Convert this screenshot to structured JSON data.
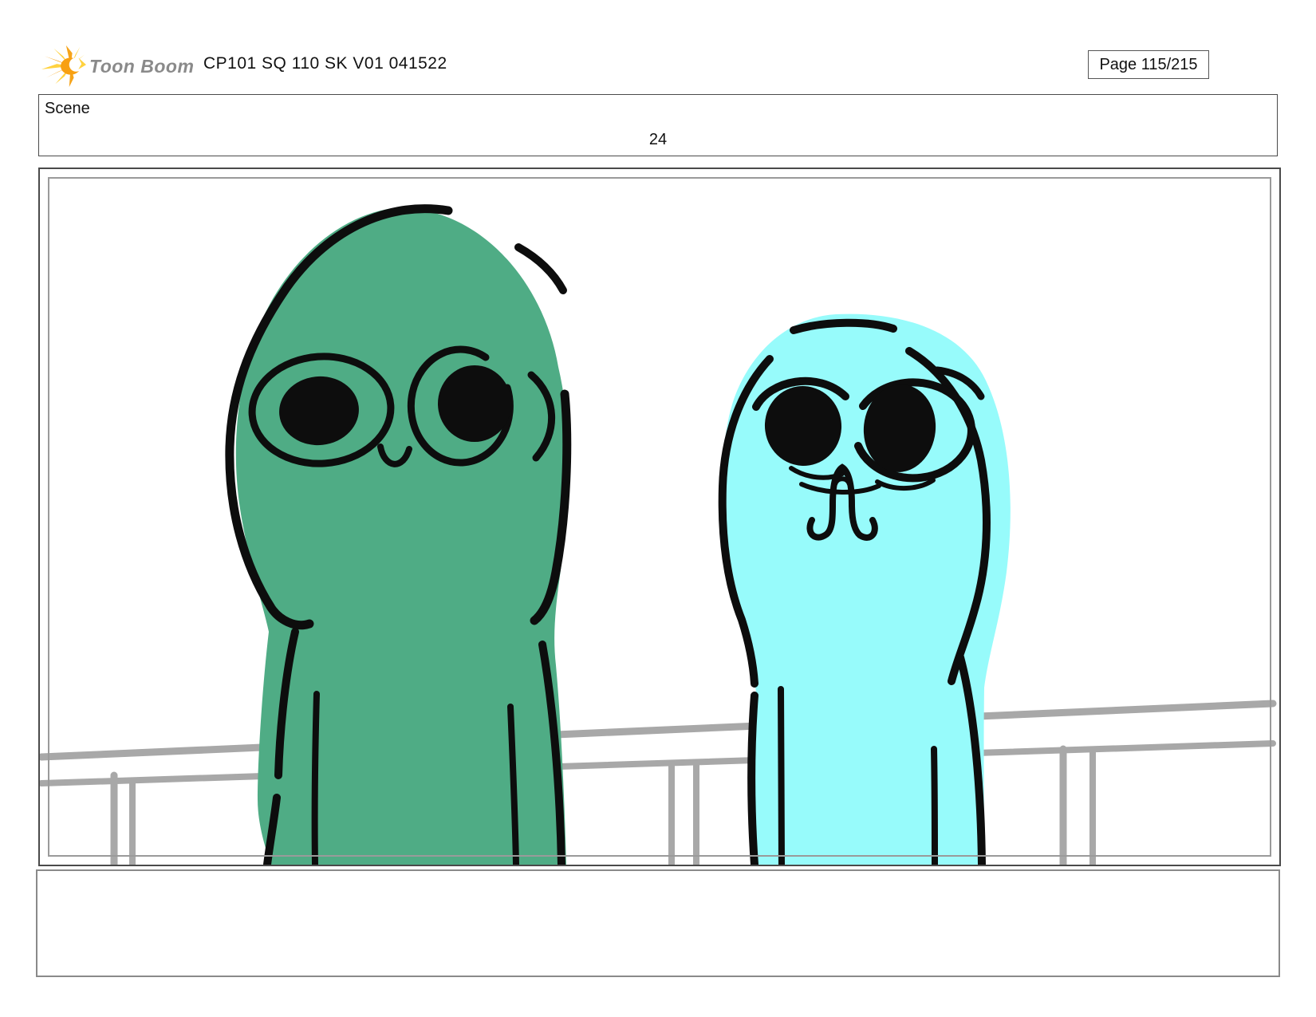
{
  "header": {
    "logo_text": "Toon Boom",
    "title": "CP101 SQ 110 SK V01 041522",
    "page_label": "Page 115/215"
  },
  "scene_row": {
    "label": "Scene",
    "number": "24"
  },
  "caption": {
    "text": ""
  },
  "panel": {
    "icon_names": [
      "toonboom-logo-icon",
      "storyboard-panel-drawing"
    ],
    "characters": [
      "green-blob-character",
      "cyan-blob-character"
    ],
    "background_element": "gray-railing"
  },
  "colors": {
    "character_green_fill": "#4fac85",
    "character_cyan_fill": "#97fbfb",
    "line_black": "#0d0d0d",
    "railing_gray": "#a8a8a8",
    "inner_border_gray": "#9a9a9a",
    "logo_yellow_dark": "#f6a41a",
    "logo_yellow_light": "#ffd23f",
    "logo_core_orange": "#f8a012",
    "logo_text_gray": "#8a8a8a"
  }
}
